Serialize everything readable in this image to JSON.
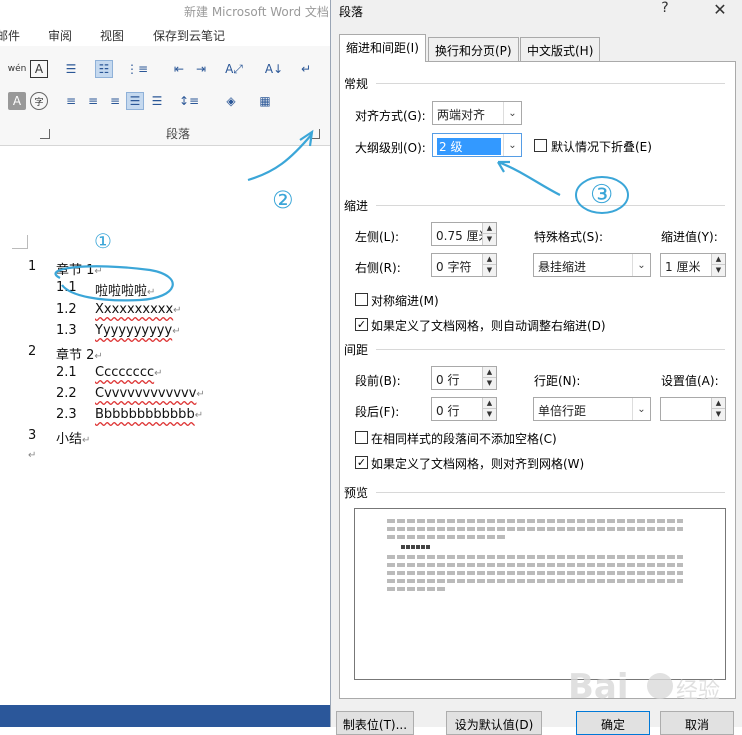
{
  "word": {
    "title": "新建 Microsoft Word 文档",
    "menu": [
      "邮件",
      "审阅",
      "视图",
      "保存到云笔记"
    ],
    "group_label": "段落",
    "headings": [
      {
        "num": "1",
        "text": "章节 1"
      },
      {
        "num": "1.1",
        "text": "啦啦啦啦"
      },
      {
        "num": "1.2",
        "text": "Xxxxxxxxxx"
      },
      {
        "num": "1.3",
        "text": "Yyyyyyyyyy"
      },
      {
        "num": "2",
        "text": "章节 2"
      },
      {
        "num": "2.1",
        "text": "Cccccccc"
      },
      {
        "num": "2.2",
        "text": "Cvvvvvvvvvvvv"
      },
      {
        "num": "2.3",
        "text": "Bbbbbbbbbbbb"
      },
      {
        "num": "3",
        "text": "小结"
      }
    ],
    "para_mark": "↵",
    "annotations": [
      "①",
      "②",
      "③"
    ],
    "icons": [
      "phonetic-guide-icon",
      "char-border-icon",
      "bullets-icon",
      "numbering-icon",
      "multilevel-list-icon",
      "decrease-indent-icon",
      "increase-indent-icon",
      "asian-layout-icon",
      "sort-icon",
      "show-marks-icon",
      "align-left-icon",
      "center-icon",
      "align-right-icon",
      "justify-icon",
      "distributed-icon",
      "line-spacing-icon",
      "shading-icon",
      "borders-icon"
    ]
  },
  "dialog": {
    "title": "段落",
    "help": "?",
    "close": "✕",
    "tabs": [
      "缩进和间距(I)",
      "换行和分页(P)",
      "中文版式(H)"
    ],
    "general": {
      "section": "常规",
      "align_label": "对齐方式(G):",
      "align_value": "两端对齐",
      "outline_label": "大纲级别(O):",
      "outline_value": "2 级",
      "collapse_label": "默认情况下折叠(E)",
      "collapse_checked": false
    },
    "indent": {
      "section": "缩进",
      "left_label": "左侧(L):",
      "left_value": "0.75 厘米",
      "right_label": "右侧(R):",
      "right_value": "0 字符",
      "special_label": "特殊格式(S):",
      "special_value": "悬挂缩进",
      "by_label": "缩进值(Y):",
      "by_value": "1 厘米",
      "mirror_label": "对称缩进(M)",
      "mirror_checked": false,
      "auto_adjust_label": "如果定义了文档网格，则自动调整右缩进(D)",
      "auto_adjust_checked": true
    },
    "spacing": {
      "section": "间距",
      "before_label": "段前(B):",
      "before_value": "0 行",
      "after_label": "段后(F):",
      "after_value": "0 行",
      "line_label": "行距(N):",
      "line_value": "单倍行距",
      "at_label": "设置值(A):",
      "at_value": "",
      "no_space_label": "在相同样式的段落间不添加空格(C)",
      "no_space_checked": false,
      "snap_grid_label": "如果定义了文档网格，则对齐到网格(W)",
      "snap_grid_checked": true
    },
    "preview": {
      "section": "预览"
    },
    "buttons": {
      "tabs": "制表位(T)...",
      "default": "设为默认值(D)",
      "ok": "确定",
      "cancel": "取消"
    },
    "check_mark": "✓",
    "spin_up": "▲",
    "spin_down": "▼",
    "drop_arrow": "⌄"
  }
}
